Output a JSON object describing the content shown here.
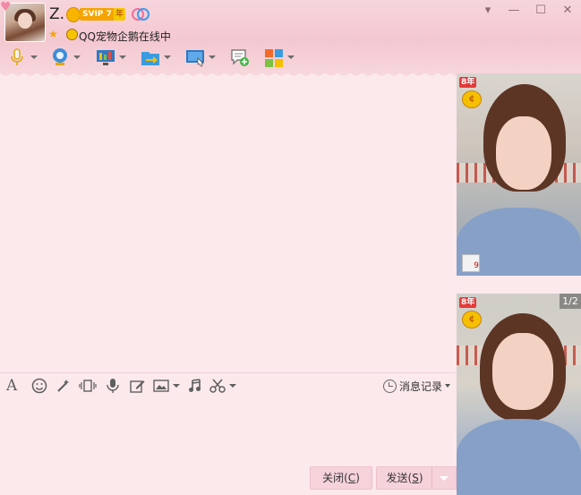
{
  "user": {
    "name": "Z.",
    "vip_badge": "SVIP 7",
    "year_badge": "年",
    "status_text": "QQ宠物企鹅在线中"
  },
  "window_controls": {
    "dropdown": "▾",
    "minimize": "—",
    "maximize": "☐",
    "close": "✕"
  },
  "toolbar": {
    "items": [
      {
        "name": "voice-call",
        "icon": "microphone-icon"
      },
      {
        "name": "video-call",
        "icon": "webcam-icon"
      },
      {
        "name": "remote-desktop",
        "icon": "monitor-icon"
      },
      {
        "name": "send-file",
        "icon": "folder-transfer-icon"
      },
      {
        "name": "screen-share",
        "icon": "screen-share-icon"
      },
      {
        "name": "create-discussion",
        "icon": "chat-add-icon"
      },
      {
        "name": "apps",
        "icon": "apps-grid-icon"
      }
    ]
  },
  "format_bar": {
    "history_label": "消息记录"
  },
  "buttons": {
    "close_label": "关闭(",
    "close_key": "C",
    "close_end": ")",
    "send_label": "发送(",
    "send_key": "S",
    "send_end": ")"
  },
  "side_panel": {
    "vip_tag": "8年",
    "coin_symbol": "¢",
    "page_indicator": "1/2",
    "thumb_count": "9"
  },
  "colors": {
    "header_pink": "#f4c8d1",
    "chat_bg": "#fbe9ec",
    "button_pink": "#f6d2db"
  }
}
